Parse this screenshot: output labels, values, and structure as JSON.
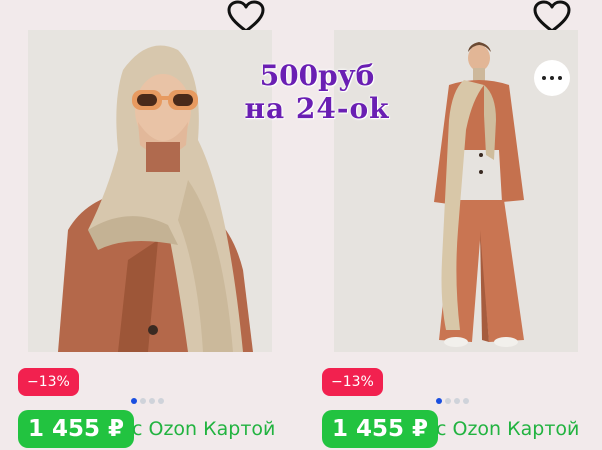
{
  "products": [
    {
      "discount": "−13%",
      "price": "1 455 ₽",
      "price_note": "с Ozon Картой",
      "image_icon": "product-photo-woman-scarf-sunglasses",
      "gallery": {
        "count": 4,
        "active": 1
      }
    },
    {
      "discount": "−13%",
      "price": "1 455 ₽",
      "price_note": "с Ozon Картой",
      "image_icon": "product-photo-woman-suit-scarf",
      "gallery": {
        "count": 4,
        "active": 1
      }
    }
  ],
  "overlay": {
    "line1": "500руб",
    "line2": "на  24-ok"
  },
  "colors": {
    "background": "#f2eaeb",
    "discount_badge": "#f2214f",
    "price_badge": "#22c340",
    "price_note": "#22b340",
    "overlay_text": "#6a1fb3",
    "active_dot": "#1a4fe0"
  }
}
